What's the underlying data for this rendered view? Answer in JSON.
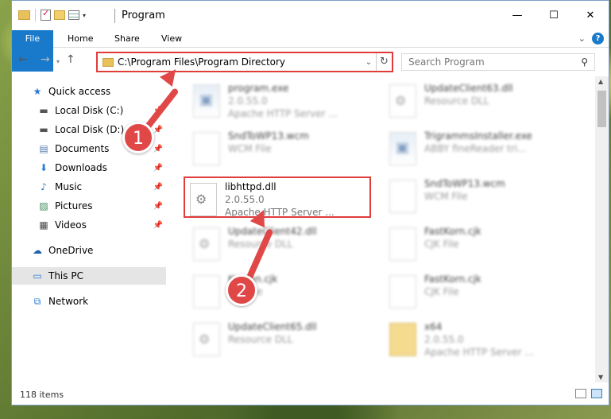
{
  "window": {
    "title": "Program",
    "buttons": {
      "minimize": "—",
      "maximize": "☐",
      "close": "✕"
    }
  },
  "ribbon": {
    "tabs": [
      "File",
      "Home",
      "Share",
      "View"
    ],
    "help": "?"
  },
  "nav": {
    "back": "←",
    "forward": "→",
    "up": "↑",
    "address": "C:\\Program Files\\Program Directory",
    "search_placeholder": "Search Program"
  },
  "sidebar": {
    "items": [
      {
        "label": "Quick access",
        "icon": "star-icon"
      },
      {
        "label": "Local Disk (C:)",
        "icon": "drive-icon",
        "pinned": true
      },
      {
        "label": "Local Disk (D:)",
        "icon": "drive-icon",
        "pinned": true
      },
      {
        "label": "Documents",
        "icon": "documents-icon",
        "pinned": true
      },
      {
        "label": "Downloads",
        "icon": "download-icon",
        "pinned": true
      },
      {
        "label": "Music",
        "icon": "music-icon",
        "pinned": true
      },
      {
        "label": "Pictures",
        "icon": "pictures-icon",
        "pinned": true
      },
      {
        "label": "Videos",
        "icon": "videos-icon",
        "pinned": true
      },
      {
        "label": "OneDrive",
        "icon": "cloud-icon"
      },
      {
        "label": "This PC",
        "icon": "computer-icon"
      },
      {
        "label": "Network",
        "icon": "network-icon"
      }
    ]
  },
  "files": [
    {
      "name": "program.exe",
      "line2": "2.0.55.0",
      "line3": "Apache HTTP Server ...",
      "icon": "exe-icon"
    },
    {
      "name": "UpdateClient63.dll",
      "line2": "Resource DLL",
      "line3": "",
      "icon": "dll-icon"
    },
    {
      "name": "SndToWP13.wcm",
      "line2": "WCM File",
      "line3": "",
      "icon": "file-icon"
    },
    {
      "name": "TrigrammsInstaller.exe",
      "line2": "ABBY fineReader tri...",
      "line3": "",
      "icon": "exe-icon"
    },
    {
      "name": "libhttpd.dll",
      "line2": "2.0.55.0",
      "line3": "Apache HTTP Server ...",
      "icon": "dll-icon"
    },
    {
      "name": "SndToWP13.wcm",
      "line2": "WCM File",
      "line3": "",
      "icon": "file-icon"
    },
    {
      "name": "UpdateClient42.dll",
      "line2": "Resource DLL",
      "line3": "",
      "icon": "dll-icon"
    },
    {
      "name": "FastKorn.cjk",
      "line2": "CJK File",
      "line3": "",
      "icon": "file-icon"
    },
    {
      "name": "Korean.cjk",
      "line2": "CJK File",
      "line3": "",
      "icon": "file-icon"
    },
    {
      "name": "FastKorn.cjk",
      "line2": "CJK File",
      "line3": "",
      "icon": "file-icon"
    },
    {
      "name": "UpdateClient65.dll",
      "line2": "Resource DLL",
      "line3": "",
      "icon": "dll-icon"
    },
    {
      "name": "x64",
      "line2": "2.0.55.0",
      "line3": "Apache HTTP Server ...",
      "icon": "folder-icon"
    }
  ],
  "status": {
    "count": "118 items"
  },
  "callouts": [
    "1",
    "2"
  ],
  "colors": {
    "accent": "#1979ca",
    "highlight": "#e03c3c",
    "selection": "#cce4f7"
  }
}
